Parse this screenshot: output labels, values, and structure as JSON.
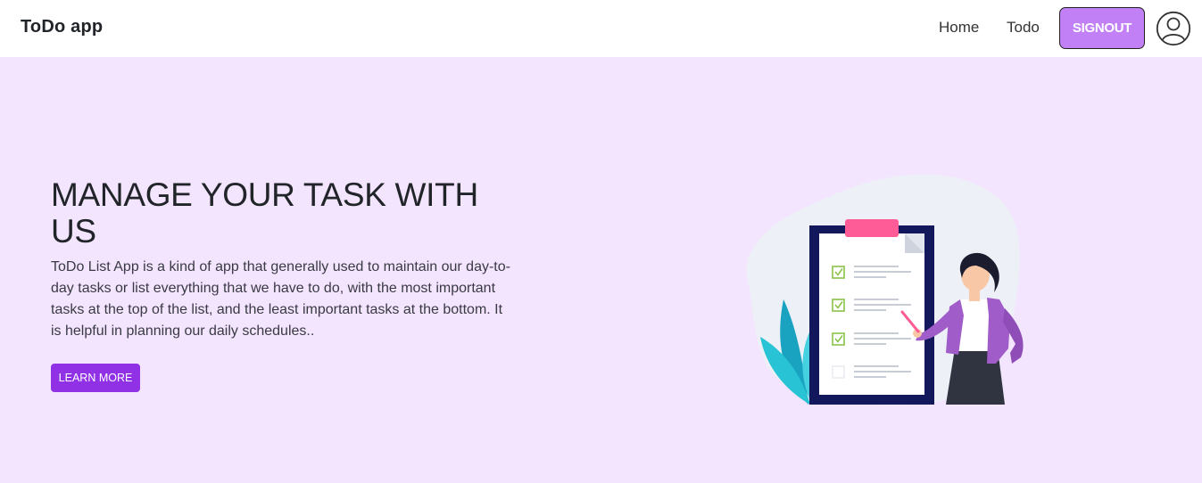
{
  "navbar": {
    "brand": "ToDo app",
    "links": [
      {
        "label": "Home"
      },
      {
        "label": "Todo"
      }
    ],
    "signout_label": "SIGNOUT",
    "avatar_icon": "user-circle-icon"
  },
  "hero": {
    "title": "MANAGE YOUR TASK WITH US",
    "description": "ToDo List App is a kind of app that generally used to maintain our day-to-day tasks or list everything that we have to do, with the most important tasks at the top of the list, and the least important tasks at the bottom. It is helpful in planning our daily schedules..",
    "button_label": "LEARN MORE",
    "illustration": "woman-with-checklist-illustration"
  },
  "colors": {
    "hero_background": "#f3e5fd",
    "signout_button": "#c180f5",
    "learn_more_button": "#9131e6",
    "clipboard": "#13185c",
    "clip": "#fe5c96",
    "check": "#8bc34a",
    "plant": "#28c3d4",
    "jacket": "#a05cc8"
  }
}
